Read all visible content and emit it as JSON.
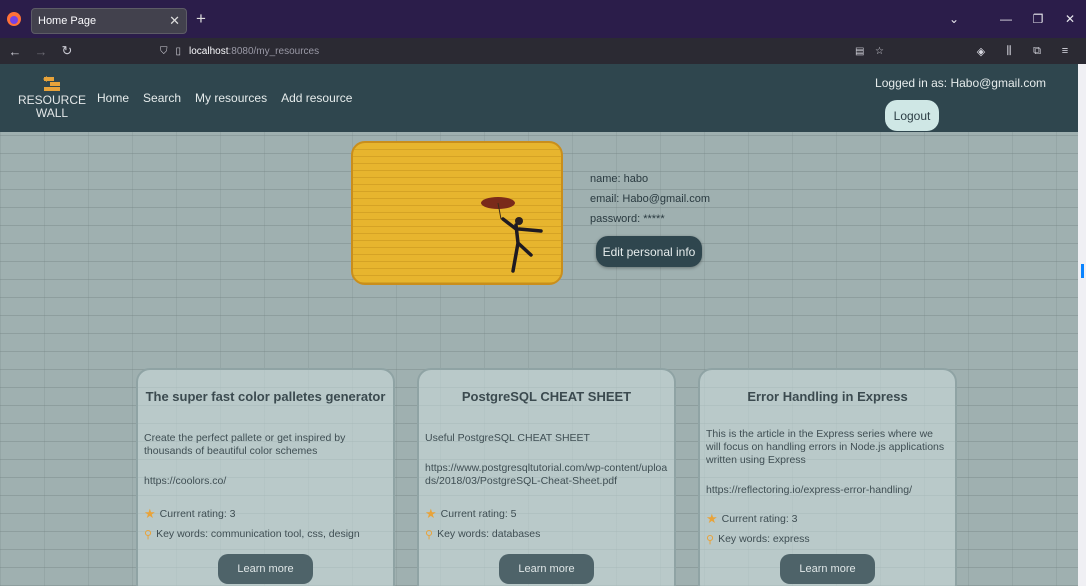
{
  "browser": {
    "tab_title": "Home Page",
    "url_host": "localhost",
    "url_path": ":8080/my_resources"
  },
  "site": {
    "logo_line1": "RESOURCE",
    "logo_line2": "WALL",
    "nav": [
      "Home",
      "Search",
      "My resources",
      "Add resource"
    ],
    "logged_in": "Logged in as: Habo@gmail.com",
    "logout": "Logout"
  },
  "profile": {
    "name": "name: habo",
    "email": "email: Habo@gmail.com",
    "password": "password: *****",
    "edit": "Edit personal info"
  },
  "cards": [
    {
      "title": "The super fast color palletes generator",
      "description": "Create the perfect pallete or get inspired by thousands of beautiful color schemes",
      "url": "https://coolors.co/",
      "rating": "Current rating: 3",
      "keywords": "Key words: communication tool, css, design",
      "button": "Learn more"
    },
    {
      "title": "PostgreSQL CHEAT SHEET",
      "description": "Useful PostgreSQL CHEAT SHEET",
      "url": "https://www.postgresqltutorial.com/wp-content/uploads/2018/03/PostgreSQL-Cheat-Sheet.pdf",
      "rating": "Current rating: 5",
      "keywords": "Key words: databases",
      "button": "Learn more"
    },
    {
      "title": "Error Handling in Express",
      "description": "This is the article in the Express series where we will focus on handling errors in Node.js applications written using Express",
      "url": "https://reflectoring.io/express-error-handling/",
      "rating": "Current rating: 3",
      "keywords": "Key words: express",
      "button": "Learn more"
    }
  ],
  "colors": {
    "header_bg": "#2f464e",
    "accent_orange": "#e8a33a",
    "photo_yellow": "#e7b52e"
  }
}
